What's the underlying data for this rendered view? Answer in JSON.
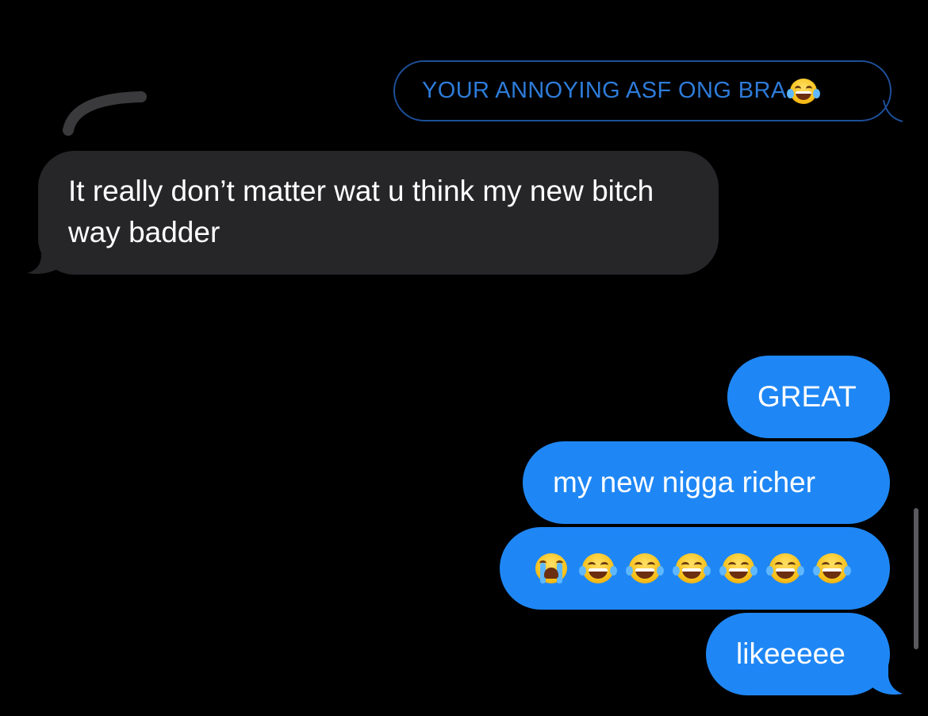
{
  "quoted_reply": {
    "text": "YOUR ANNOYING ASF ONG BRA",
    "emoji": "face-with-tears-of-joy"
  },
  "received_message": {
    "text": "It really don’t matter wat u think my new bitch way badder"
  },
  "sent_messages": [
    {
      "text": "GREAT"
    },
    {
      "text": "my new nigga richer"
    },
    {
      "emojis": [
        "loudly-crying-face",
        "face-with-tears-of-joy",
        "face-with-tears-of-joy",
        "face-with-tears-of-joy",
        "face-with-tears-of-joy",
        "face-with-tears-of-joy",
        "face-with-tears-of-joy"
      ]
    },
    {
      "text": "likeeeee"
    }
  ],
  "colors": {
    "background": "#000000",
    "sent_bubble": "#1f87f5",
    "received_bubble": "#262629",
    "quoted_outline": "#1d4f99",
    "quoted_text": "#2e7bd9",
    "reply_connector": "#3a3a3c"
  }
}
